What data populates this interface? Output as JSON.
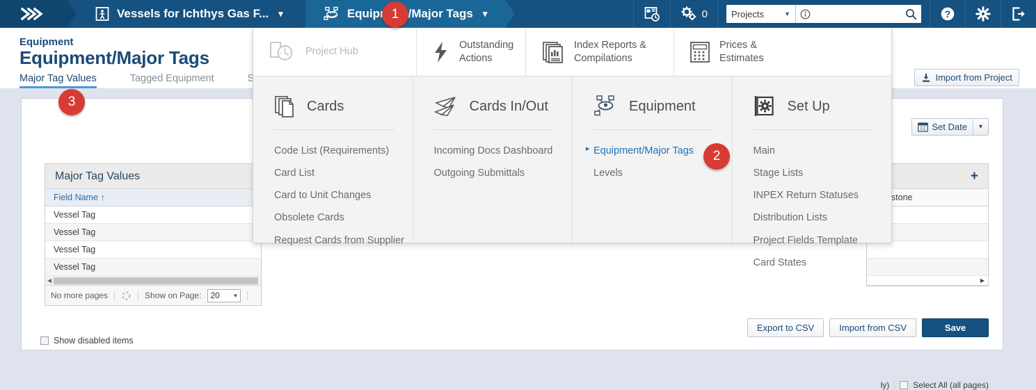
{
  "topbar": {
    "home_icon": "chevrons-right-icon",
    "breadcrumbs": [
      {
        "icon": "vessel-icon",
        "label": "Vessels for Ichthys Gas F...",
        "caret": "⌄"
      },
      {
        "icon": "equipment-tags-icon",
        "label": "Equipment/Major Tags",
        "caret": "⌄"
      }
    ],
    "calendar_history_icon": "calendar-clock-icon",
    "gears_icon": "gears-icon",
    "gears_count": "0",
    "project_select": {
      "value": "Projects",
      "caret": "▼"
    },
    "search": {
      "placeholder": "",
      "value": "",
      "info_icon": "info-icon",
      "search_icon": "search-icon"
    },
    "help_icon": "help-icon",
    "settings_icon": "gear-icon",
    "logout_icon": "logout-icon"
  },
  "page": {
    "eyebrow": "Equipment",
    "title": "Equipment/Major Tags",
    "tabs": [
      {
        "label": "Major Tag Values",
        "active": true
      },
      {
        "label": "Tagged Equipment",
        "active": false
      },
      {
        "label": "Steel",
        "active": false
      }
    ],
    "import_from_project": "Import from Project"
  },
  "toolbar": {
    "set_date": "Set Date",
    "set_date_caret": "⌄"
  },
  "grid_left": {
    "title": "Major Tag Values",
    "columns": [
      "Field Name ↑"
    ],
    "rows": [
      "Vessel Tag",
      "Vessel Tag",
      "Vessel Tag",
      "Vessel Tag"
    ],
    "footer": {
      "pages_text": "No more pages",
      "refresh_icon": "refresh-icon",
      "show_on_page_label": "Show on Page:",
      "show_on_page_value": "20",
      "caret": "⌄"
    }
  },
  "grid_right": {
    "add_label": "+",
    "columns": [
      "Milestone"
    ],
    "row_count": 4,
    "scroll_arrow": "▶"
  },
  "footer": {
    "select_all_label": "Select All (all pages)",
    "partial_label_behind_menu": "ly)",
    "show_disabled_items": "Show disabled items",
    "buttons": [
      {
        "label": "Export to CSV",
        "primary": false
      },
      {
        "label": "Import from CSV",
        "primary": false
      },
      {
        "label": "Save",
        "primary": true
      }
    ]
  },
  "megamenu": {
    "top_items": [
      {
        "label": "Project Hub",
        "icon": "project-hub-icon",
        "disabled": true
      },
      {
        "label": "Outstanding\nActions",
        "line1": "Outstanding",
        "line2": "Actions",
        "icon": "lightning-icon",
        "disabled": false
      },
      {
        "label": "Index Reports &\nCompilations",
        "line1": "Index Reports &",
        "line2": "Compilations",
        "icon": "reports-stack-icon",
        "disabled": false
      },
      {
        "label": "Prices &\nEstimates",
        "line1": "Prices &",
        "line2": "Estimates",
        "icon": "calculator-icon",
        "disabled": false
      }
    ],
    "columns": [
      {
        "title": "Cards",
        "icon": "cards-icon",
        "links": [
          {
            "label": "Code List (Requirements)",
            "current": false
          },
          {
            "label": "Card List",
            "current": false
          },
          {
            "label": "Card to Unit Changes",
            "current": false
          },
          {
            "label": "Obsolete Cards",
            "current": false
          },
          {
            "label": "Request Cards from Supplier",
            "current": false
          }
        ]
      },
      {
        "title": "Cards In/Out",
        "icon": "paper-planes-icon",
        "links": [
          {
            "label": "Incoming Docs Dashboard",
            "current": false
          },
          {
            "label": "Outgoing Submittals",
            "current": false
          }
        ]
      },
      {
        "title": "Equipment",
        "icon": "equipment-icon",
        "links": [
          {
            "label": "Equipment/Major Tags",
            "current": true
          },
          {
            "label": "Levels",
            "current": false
          }
        ]
      },
      {
        "title": "Set Up",
        "icon": "setup-gear-icon",
        "links": [
          {
            "label": "Main",
            "current": false
          },
          {
            "label": "Stage Lists",
            "current": false
          },
          {
            "label": "INPEX Return Statuses",
            "current": false
          },
          {
            "label": "Distribution Lists",
            "current": false
          },
          {
            "label": "Project Fields Template",
            "current": false
          },
          {
            "label": "Card States",
            "current": false
          }
        ]
      }
    ]
  },
  "callouts": [
    {
      "number": "1"
    },
    {
      "number": "2"
    },
    {
      "number": "3"
    }
  ],
  "colors": {
    "nav_blue": "#155181",
    "accent_blue": "#1f6fb5",
    "title_blue": "#1c4a77",
    "callout_red": "#d63b34",
    "canvas_bg": "#dfe3ed"
  }
}
